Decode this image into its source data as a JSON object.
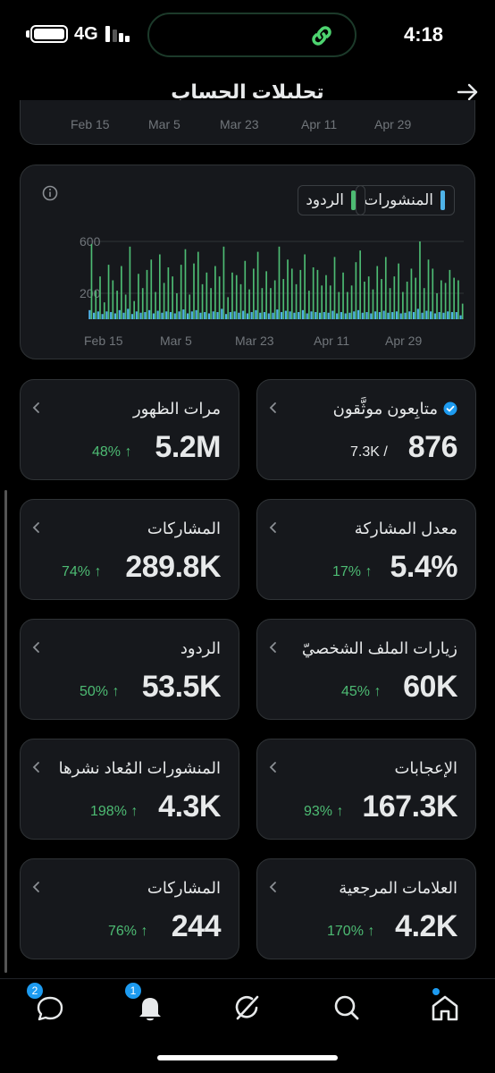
{
  "status_bar": {
    "network": "4G",
    "time": "4:18"
  },
  "header": {
    "title": "تحليلات الحساب"
  },
  "top_chart_axis": [
    "Feb 15",
    "Mar 5",
    "Mar 23",
    "Apr 11",
    "Apr 29"
  ],
  "chart_data": {
    "type": "bar",
    "legend_placement": "top-right",
    "series": [
      {
        "name": "المنشورات",
        "color": "#4fb3e8"
      },
      {
        "name": "الردود",
        "color": "#4dbb73"
      }
    ],
    "x_ticks": [
      "Feb 15",
      "Mar 5",
      "Mar 23",
      "Apr 11",
      "Apr 29"
    ],
    "y_ticks": [
      "600",
      "200"
    ],
    "ylim": [
      0,
      700
    ],
    "replies": [
      580,
      220,
      330,
      130,
      420,
      300,
      220,
      410,
      190,
      560,
      140,
      350,
      240,
      380,
      460,
      210,
      500,
      280,
      400,
      330,
      200,
      420,
      540,
      190,
      430,
      520,
      270,
      360,
      240,
      410,
      330,
      560,
      170,
      360,
      340,
      270,
      450,
      230,
      390,
      520,
      240,
      370,
      240,
      300,
      560,
      310,
      460,
      390,
      270,
      380,
      500,
      220,
      400,
      380,
      260,
      340,
      260,
      480,
      210,
      360,
      210,
      260,
      440,
      530,
      290,
      330,
      230,
      410,
      310,
      480,
      240,
      330,
      430,
      210,
      290,
      390,
      320,
      600,
      240,
      460,
      390,
      200,
      300,
      280,
      380,
      320,
      300,
      120
    ],
    "posts": [
      70,
      50,
      60,
      40,
      60,
      55,
      45,
      70,
      50,
      80,
      40,
      60,
      50,
      55,
      70,
      45,
      65,
      50,
      60,
      55,
      45,
      60,
      75,
      45,
      60,
      70,
      50,
      55,
      45,
      60,
      55,
      80,
      40,
      55,
      60,
      50,
      65,
      45,
      55,
      70,
      50,
      55,
      45,
      50,
      75,
      55,
      65,
      60,
      50,
      55,
      70,
      45,
      60,
      55,
      50,
      55,
      50,
      65,
      45,
      55,
      45,
      50,
      60,
      70,
      50,
      55,
      45,
      60,
      55,
      65,
      50,
      55,
      60,
      45,
      50,
      60,
      55,
      80,
      50,
      65,
      60,
      45,
      55,
      50,
      60,
      55,
      55,
      30
    ]
  },
  "metrics": [
    {
      "label": "متابِعون موثَّقون",
      "value": "876",
      "total": "7.3K /",
      "verified": true
    },
    {
      "label": "مرات الظهور",
      "value": "5.2M",
      "change": "48% ↑"
    },
    {
      "label": "معدل المشاركة",
      "value": "5.4%",
      "change": "17% ↑"
    },
    {
      "label": "المشاركات",
      "value": "289.8K",
      "change": "74% ↑"
    },
    {
      "label": "زيارات الملف الشخصيّ",
      "value": "60K",
      "change": "45% ↑"
    },
    {
      "label": "الردود",
      "value": "53.5K",
      "change": "50% ↑"
    },
    {
      "label": "الإعجابات",
      "value": "167.3K",
      "change": "93% ↑"
    },
    {
      "label": "المنشورات المُعاد نشرها",
      "value": "4.3K",
      "change": "198% ↑"
    },
    {
      "label": "العلامات المرجعية",
      "value": "4.2K",
      "change": "170% ↑"
    },
    {
      "label": "المشاركات",
      "value": "244",
      "change": "76% ↑"
    }
  ],
  "nav": {
    "messages_badge": "2",
    "notifications_badge": "1"
  }
}
